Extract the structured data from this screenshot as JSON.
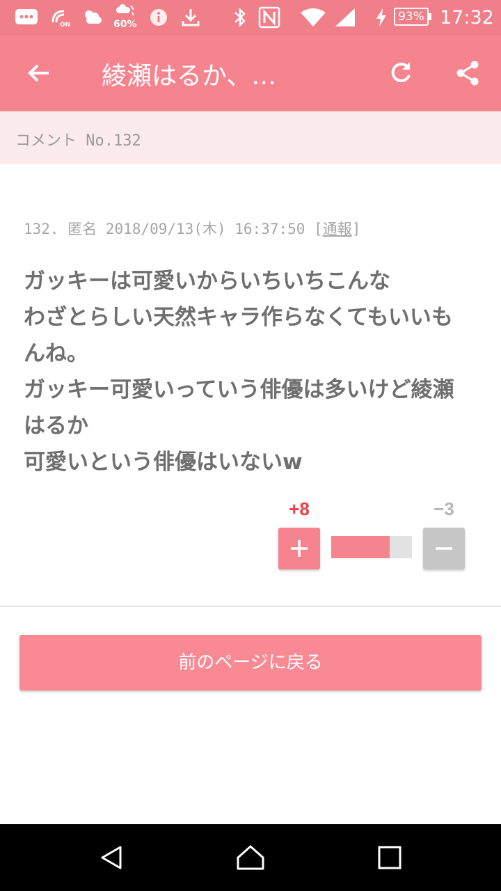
{
  "status_bar": {
    "weather_text": "60%",
    "battery_percent": "93%",
    "time": "17:32",
    "icons": [
      "message-icon",
      "nfc-on-icon",
      "weather-icon",
      "rain-icon",
      "info-icon",
      "download-icon",
      "bluetooth-icon",
      "n-mark-icon",
      "wifi-icon",
      "signal-icon",
      "charging-icon",
      "battery-icon"
    ]
  },
  "app_bar": {
    "title": "綾瀬はるか、…",
    "back_icon": "arrow-left-icon",
    "refresh_icon": "refresh-icon",
    "share_icon": "share-icon"
  },
  "comment_header": {
    "label": "コメント No.132"
  },
  "comment": {
    "number": "132.",
    "author": "匿名",
    "date": "2018/09/13(木)",
    "time": "16:37:50",
    "report_label": "通報",
    "lines": [
      "ガッキーは可愛いからいちいちこんな",
      "わざとらしい天然キャラ作らなくてもいいも",
      "んね。",
      "ガッキー可愛いっていう俳優は多いけど綾瀬",
      "はるか",
      "可愛いという俳優はいないw"
    ]
  },
  "votes": {
    "plus_count": "+8",
    "minus_count": "−3",
    "plus_value": 8,
    "minus_value": 3,
    "plus_color": "#f6848f",
    "minus_color": "#c6c6c6"
  },
  "back_button": {
    "label": "前のページに戻る"
  },
  "colors": {
    "accent": "#f6848f",
    "header_bg": "#fcebed"
  }
}
